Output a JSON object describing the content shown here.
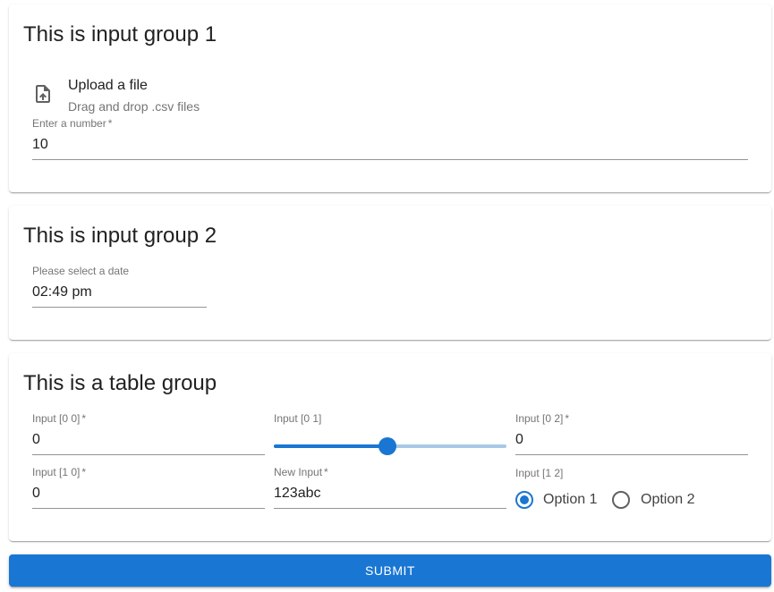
{
  "group1": {
    "title": "This is input group 1",
    "upload": {
      "icon": "file-upload-icon",
      "title": "Upload a file",
      "subtitle": "Drag and drop .csv files"
    },
    "number_field": {
      "label": "Enter a number",
      "required_mark": "*",
      "value": "10"
    }
  },
  "group2": {
    "title": "This is input group 2",
    "time_field": {
      "label": "Please select a date",
      "value": "02:49 pm"
    }
  },
  "table_group": {
    "title": "This is a table group",
    "input_0_0": {
      "label": "Input [0 0]",
      "required_mark": "*",
      "value": "0"
    },
    "input_0_1": {
      "label": "Input [0 1]",
      "slider_fraction": 0.49
    },
    "input_0_2": {
      "label": "Input [0 2]",
      "required_mark": "*",
      "value": "0"
    },
    "input_1_0": {
      "label": "Input [1 0]",
      "required_mark": "*",
      "value": "0"
    },
    "new_input": {
      "label": "New Input",
      "required_mark": "*",
      "value": "123abc"
    },
    "input_1_2": {
      "label": "Input [1 2]",
      "options": [
        "Option 1",
        "Option 2"
      ],
      "selected": "Option 1"
    }
  },
  "submit_label": "SUBMIT",
  "colors": {
    "primary": "#1976d2",
    "slider_rest": "#a8c9e6"
  }
}
